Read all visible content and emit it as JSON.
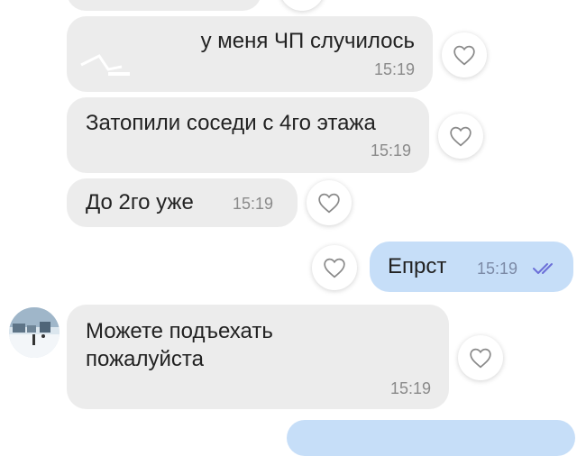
{
  "messages": [
    {
      "text": "у меня ЧП случилось",
      "time": "15:19",
      "direction": "incoming"
    },
    {
      "text": "Затопили соседи с 4го этажа",
      "time": "15:19",
      "direction": "incoming"
    },
    {
      "text": "До 2го уже",
      "time": "15:19",
      "direction": "incoming"
    },
    {
      "text": "Епрст",
      "time": "15:19",
      "direction": "outgoing",
      "status": "read"
    },
    {
      "text_line1": "Можете подъехать",
      "text_line2": "пожалуйста",
      "time": "15:19",
      "direction": "incoming"
    }
  ],
  "icons": {
    "like": "heart-outline-icon",
    "read_status": "double-check-icon"
  },
  "colors": {
    "incoming_bubble": "#ececec",
    "outgoing_bubble": "#c6def8",
    "read_check": "#6b6fd8",
    "background": "#ffffff"
  }
}
